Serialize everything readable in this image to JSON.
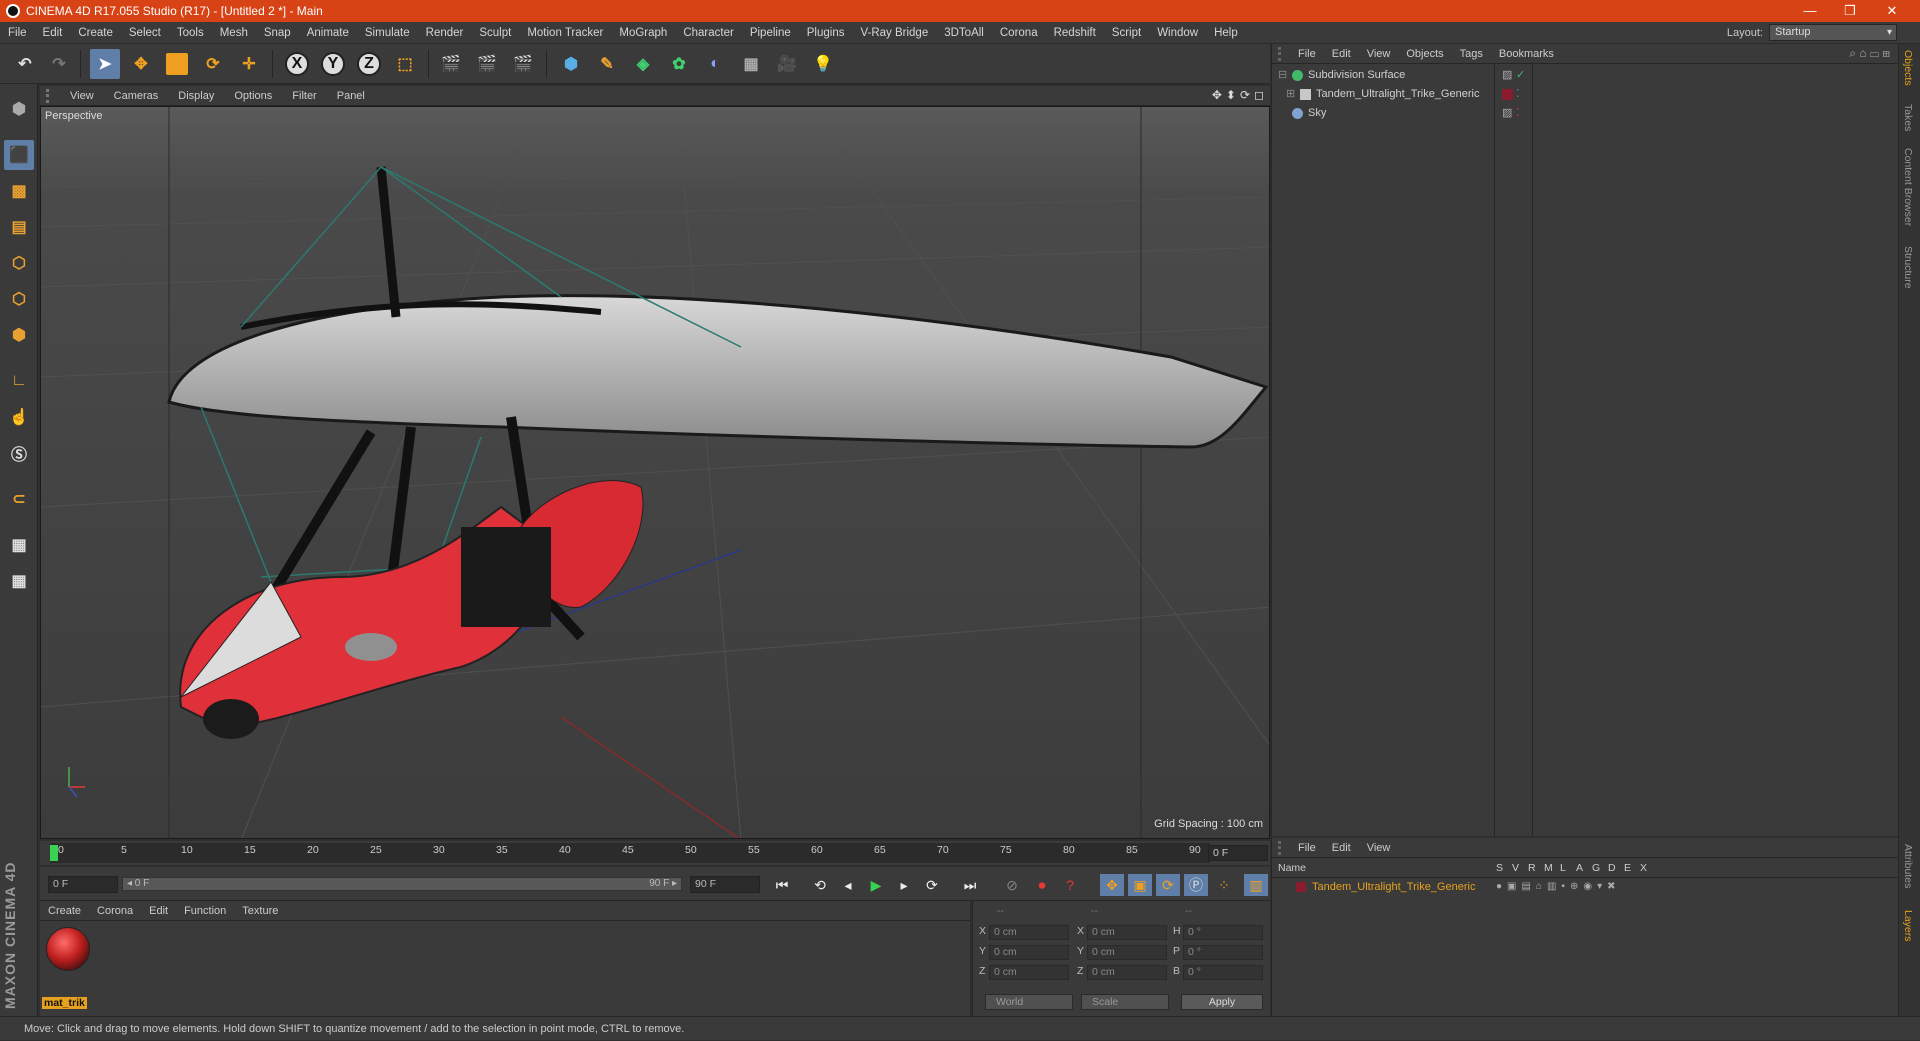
{
  "window": {
    "title": "CINEMA 4D R17.055 Studio (R17) - [Untitled 2 *] - Main",
    "controls": [
      "—",
      "❐",
      "✕"
    ]
  },
  "menubar": {
    "items": [
      "File",
      "Edit",
      "Create",
      "Select",
      "Tools",
      "Mesh",
      "Snap",
      "Animate",
      "Simulate",
      "Render",
      "Sculpt",
      "Motion Tracker",
      "MoGraph",
      "Character",
      "Pipeline",
      "Plugins",
      "V-Ray Bridge",
      "3DToAll",
      "Corona",
      "Redshift",
      "Script",
      "Window",
      "Help"
    ],
    "layout_label": "Layout:",
    "layout_value": "Startup"
  },
  "toolbar": {
    "icons": [
      "undo-icon",
      "redo-icon",
      "select-arrow-icon",
      "move-icon",
      "scale-icon",
      "rotate-icon",
      "live-select-icon",
      "x-axis-icon",
      "y-axis-icon",
      "z-axis-icon",
      "world-coord-icon",
      "render-view-icon",
      "render-picture-viewer-icon",
      "render-settings-icon",
      "cube-icon",
      "pen-spline-icon",
      "subdivision-icon",
      "cloner-icon",
      "deformer-icon",
      "floor-icon",
      "camera-icon",
      "light-icon"
    ],
    "axis_labels": [
      "X",
      "Y",
      "Z"
    ]
  },
  "viewport": {
    "menu": [
      "View",
      "Cameras",
      "Display",
      "Options",
      "Filter",
      "Panel"
    ],
    "label": "Perspective",
    "grid_spacing": "Grid Spacing : 100 cm",
    "nav_icons": [
      "✥",
      "⬍",
      "⟳",
      "◻"
    ]
  },
  "timeline": {
    "ticks": [
      "0",
      "5",
      "10",
      "15",
      "20",
      "25",
      "30",
      "35",
      "40",
      "45",
      "50",
      "55",
      "60",
      "65",
      "70",
      "75",
      "80",
      "85",
      "90"
    ],
    "current_frame": "0 F"
  },
  "transport": {
    "start_field": "0 F",
    "slider_left": "◂ 0 F",
    "slider_right": "90 F ▸",
    "end_field": "90 F"
  },
  "material_manager": {
    "menu": [
      "Create",
      "Corona",
      "Edit",
      "Function",
      "Texture"
    ],
    "materials": [
      {
        "name": "mat_trik"
      }
    ]
  },
  "coordinates": {
    "headers": [
      "--",
      "--",
      "--"
    ],
    "rows": [
      {
        "a": "X",
        "av": "0 cm",
        "b": "X",
        "bv": "0 cm",
        "c": "H",
        "cv": "0 °"
      },
      {
        "a": "Y",
        "av": "0 cm",
        "b": "Y",
        "bv": "0 cm",
        "c": "P",
        "cv": "0 °"
      },
      {
        "a": "Z",
        "av": "0 cm",
        "b": "Z",
        "bv": "0 cm",
        "c": "B",
        "cv": "0 °"
      }
    ],
    "mode1": "World",
    "mode2": "Scale",
    "apply": "Apply"
  },
  "object_manager": {
    "menu": [
      "File",
      "Edit",
      "View",
      "Objects",
      "Tags",
      "Bookmarks"
    ],
    "objects": [
      {
        "name": "Subdivision Surface",
        "color": "#43b96a"
      },
      {
        "name": "Tandem_Ultralight_Trike_Generic",
        "color": "#c8c8c8"
      },
      {
        "name": "Sky",
        "color": "#7ea4cf"
      }
    ]
  },
  "layer_manager": {
    "menu": [
      "File",
      "Edit",
      "View"
    ],
    "columns": [
      "Name",
      "S",
      "V",
      "R",
      "M",
      "L",
      "A",
      "G",
      "D",
      "E",
      "X"
    ],
    "layers": [
      {
        "name": "Tandem_Ultralight_Trike_Generic",
        "color": "#8a1c2e"
      }
    ]
  },
  "right_dock": {
    "tabs_top": [
      "Objects",
      "Takes",
      "Content Browser",
      "Structure"
    ],
    "tabs_bottom": [
      "Attributes",
      "Layers"
    ]
  },
  "status": {
    "text": "Move: Click and drag to move elements. Hold down SHIFT to quantize movement / add to the selection in point mode, CTRL to remove."
  },
  "brand": {
    "text": "MAXON CINEMA 4D"
  },
  "colors": {
    "titlebar": "#d84315",
    "accent": "#e6a21e",
    "select": "#5f7fa8"
  }
}
